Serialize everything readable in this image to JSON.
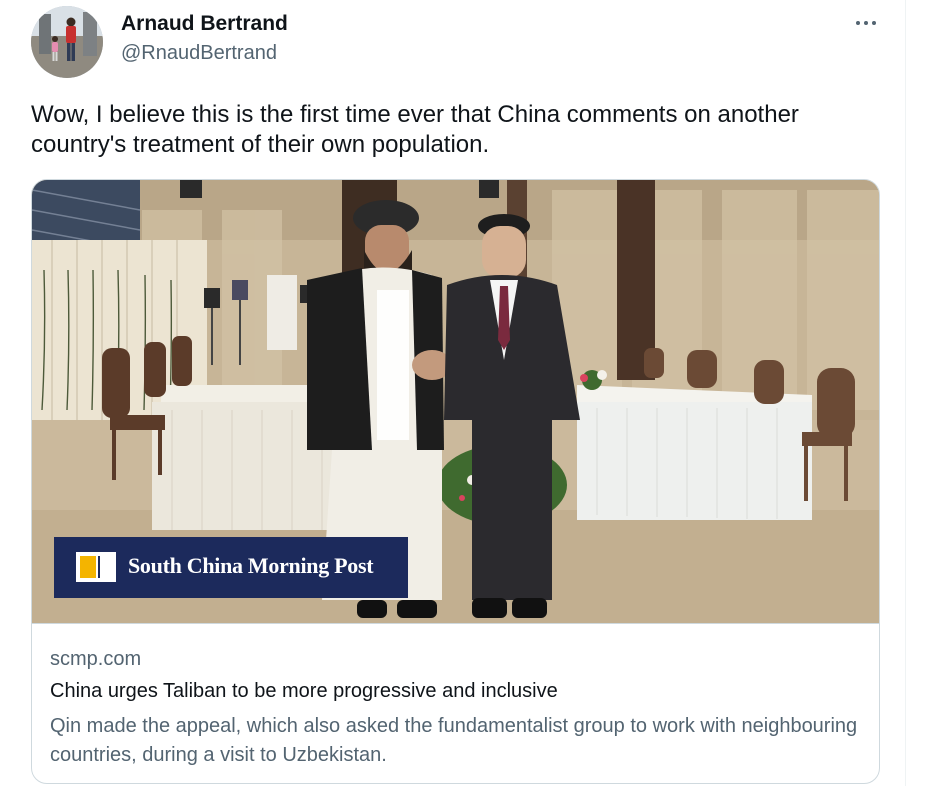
{
  "author": {
    "name": "Arnaud Bertrand",
    "handle": "@RnaudBertrand"
  },
  "more_icon": "more-horizontal-icon",
  "tweet": {
    "text": "Wow, I believe this is the first time ever that China comments on another country's treatment of their own population."
  },
  "card": {
    "image_watermark": "South China Morning Post",
    "domain": "scmp.com",
    "title": "China urges Taliban to be more progressive and inclusive",
    "description": "Qin made the appeal, which also asked the fundamentalist group to work with neighbouring countries, during a visit to Uzbekistan."
  },
  "colors": {
    "text_primary": "#0f1419",
    "text_secondary": "#536471",
    "border": "#cfd9de",
    "watermark_bg": "#1c2a5c",
    "watermark_accent": "#f4b400"
  }
}
